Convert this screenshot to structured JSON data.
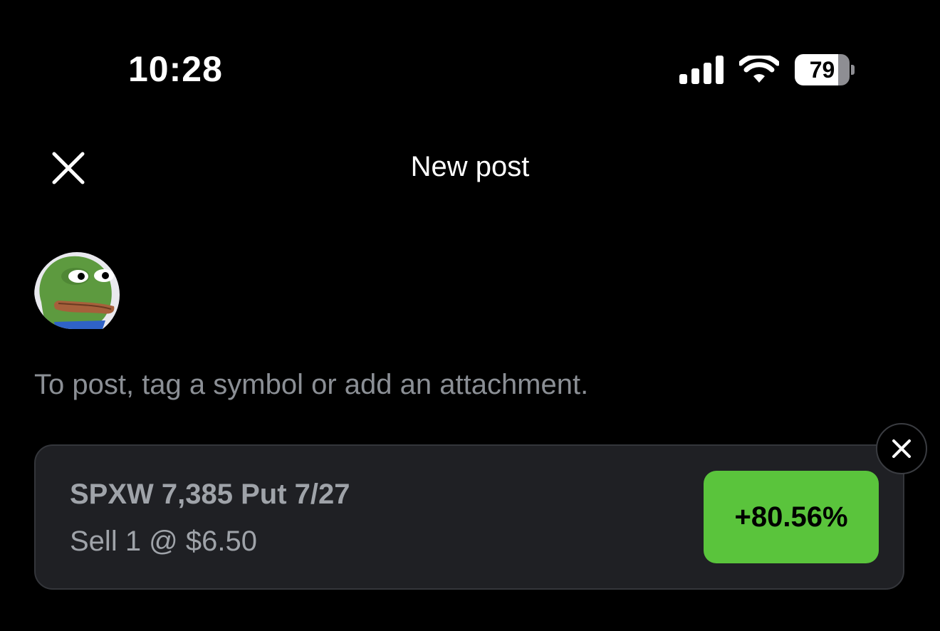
{
  "status_bar": {
    "time": "10:28",
    "battery_level": "79",
    "battery_fraction": 0.79,
    "signal_icon": "signal-bars-icon",
    "wifi_icon": "wifi-icon"
  },
  "header": {
    "title": "New post",
    "close_icon": "close-icon"
  },
  "composer": {
    "avatar": "frog-avatar",
    "hint": "To post, tag a symbol or add an attachment."
  },
  "attachment": {
    "title": "SPXW 7,385 Put 7/27",
    "subtitle": "Sell 1 @ $6.50",
    "percent_change": "+80.56%",
    "badge_color": "#5ac43c",
    "remove_icon": "close-icon"
  }
}
